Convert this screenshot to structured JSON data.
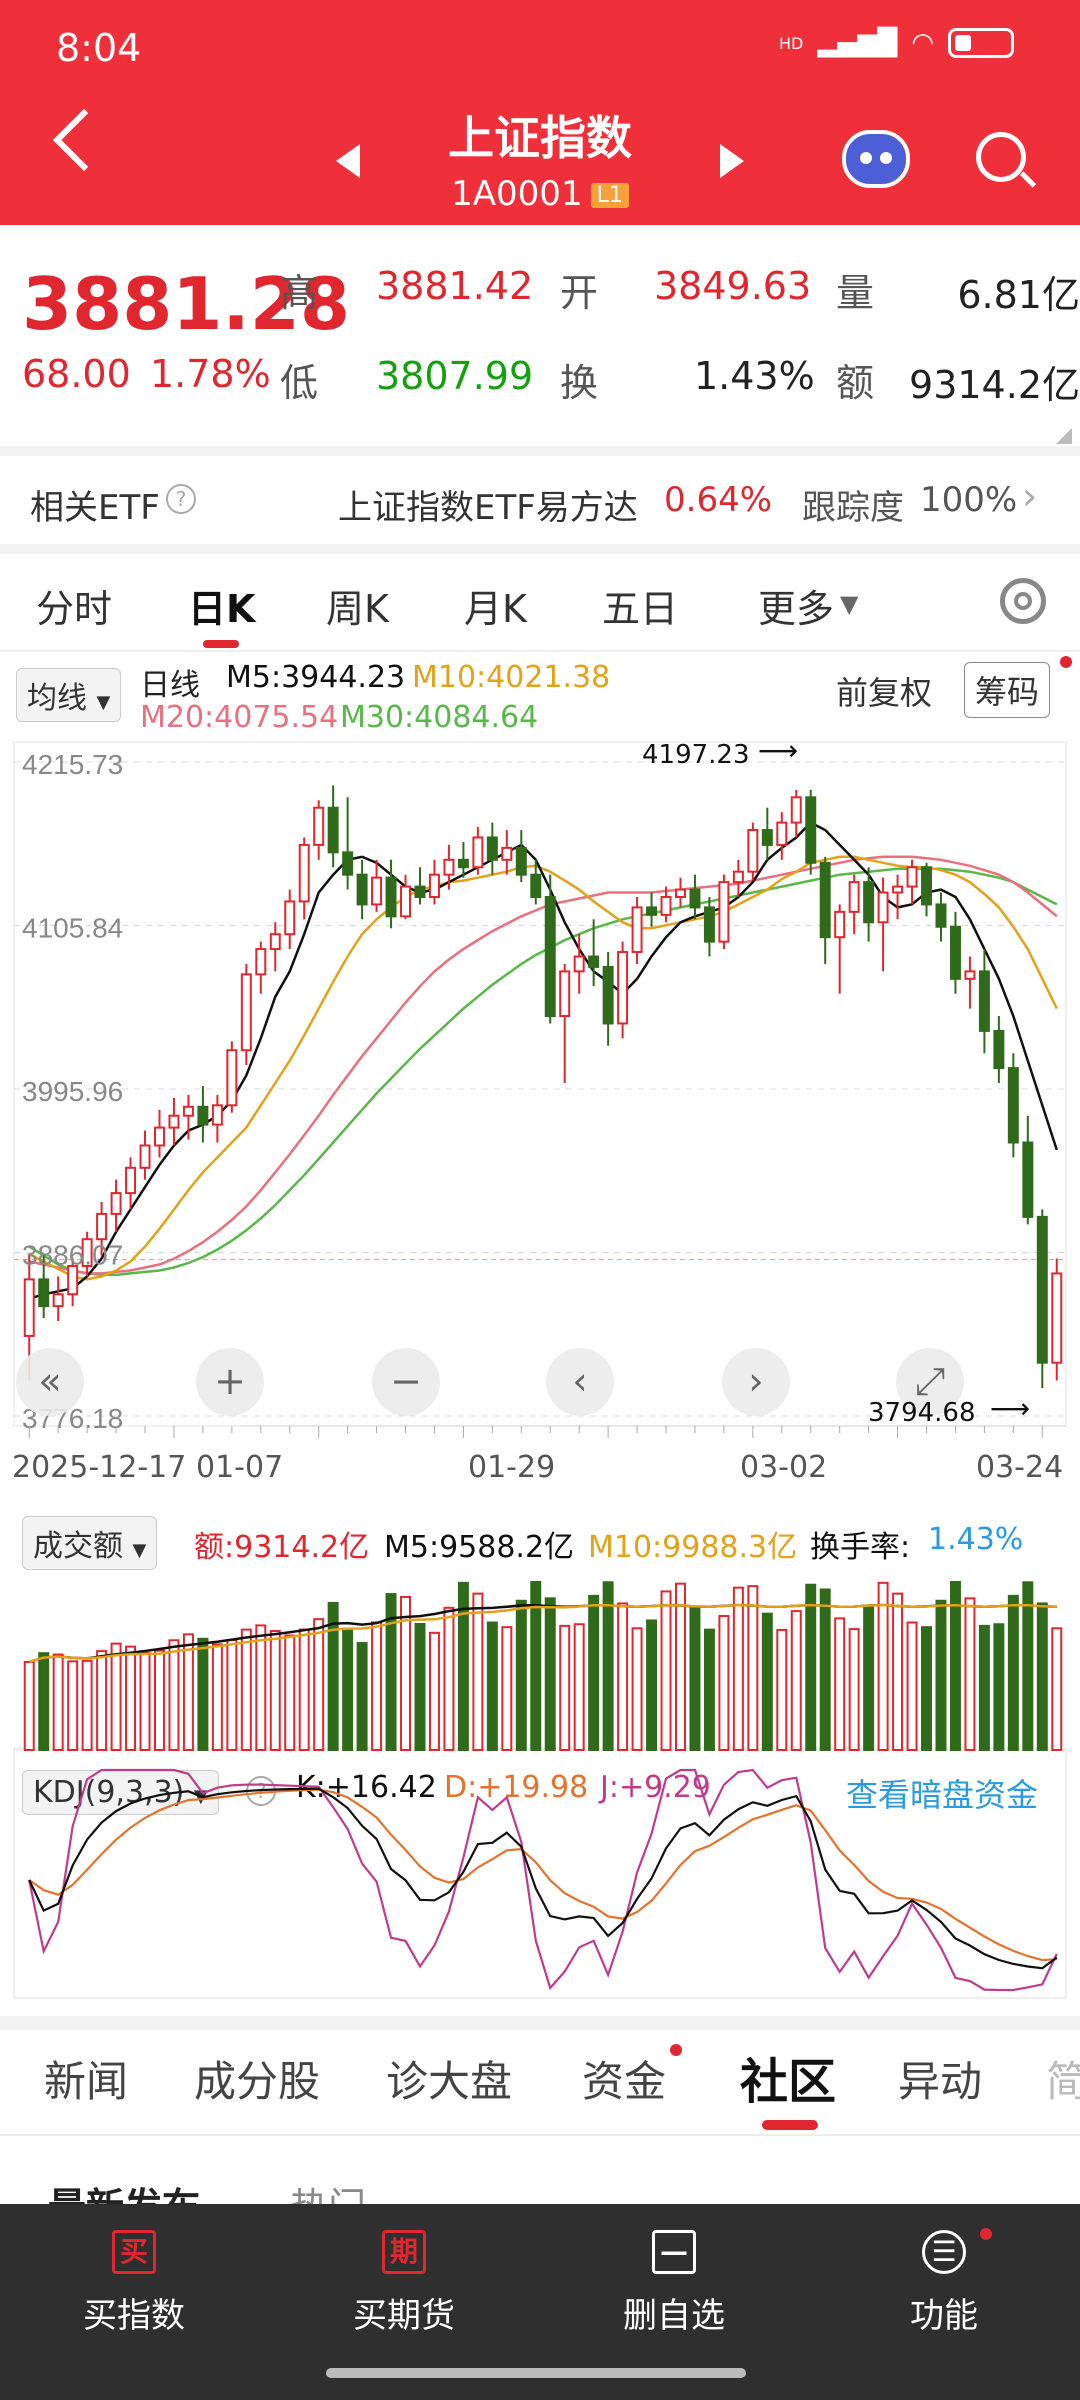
{
  "status": {
    "time": "8:04",
    "signal": "HD"
  },
  "header": {
    "title": "上证指数",
    "code": "1A0001",
    "level_badge": "L1"
  },
  "quote": {
    "price": "3881.28",
    "change": "68.00",
    "change_pct": "1.78%",
    "high_label": "高",
    "high": "3881.42",
    "open_label": "开",
    "open": "3849.63",
    "volume_label": "量",
    "volume": "6.81亿",
    "low_label": "低",
    "low": "3807.99",
    "turnover_label": "换",
    "turnover": "1.43%",
    "amount_label": "额",
    "amount": "9314.2亿"
  },
  "etf": {
    "label": "相关ETF",
    "name": "上证指数ETF易方达",
    "pct": "0.64%",
    "track_label": "跟踪度",
    "track": "100%"
  },
  "tabs": [
    "分时",
    "日K",
    "周K",
    "月K",
    "五日",
    "更多"
  ],
  "kline": {
    "ma_selector": "均线",
    "period": "日线",
    "m5": "M5:3944.23",
    "m10": "M10:4021.38",
    "m20": "M20:4075.54",
    "m30": "M30:4084.64",
    "adjust": "前复权",
    "chip_button": "筹码",
    "y_ticks": [
      "4215.73",
      "4105.84",
      "3995.96",
      "3886.07",
      "3776.18"
    ],
    "x_ticks": [
      "2025-12-17",
      "01-07",
      "01-29",
      "03-02",
      "03-24"
    ],
    "max_label": "4197.23",
    "min_label": "3794.68"
  },
  "volume": {
    "selector": "成交额",
    "amount": "额:9314.2亿",
    "m5": "M5:9588.2亿",
    "m10": "M10:9988.3亿",
    "turnover_label": "换手率:",
    "turnover": "1.43%"
  },
  "kdj": {
    "selector": "KDJ(9,3,3)",
    "k": "K:+16.42",
    "d": "D:+19.98",
    "j": "J:+9.29",
    "link": "查看暗盘资金"
  },
  "bottom_tabs": [
    "新闻",
    "成分股",
    "诊大盘",
    "资金",
    "社区",
    "异动"
  ],
  "sub_row": {
    "latest": "最新发布",
    "hot": "热门"
  },
  "nav": [
    {
      "icon": "买",
      "label": "买指数"
    },
    {
      "icon": "期",
      "label": "买期货"
    },
    {
      "icon": "—",
      "label": "删自选"
    },
    {
      "icon": "☰",
      "label": "功能"
    }
  ],
  "colors": {
    "up": "#e0262f",
    "down": "#2f6b1a",
    "header": "#ef2f3a",
    "m5": "#111111",
    "m10": "#e3a21a",
    "m20": "#e8707f",
    "m30": "#58b84a"
  },
  "chart_data": {
    "type": "candlestick",
    "ylim": [
      3776.18,
      4215.73
    ],
    "candles_ohlc": [
      [
        3830,
        3885,
        3800,
        3868
      ],
      [
        3868,
        3884,
        3842,
        3850
      ],
      [
        3850,
        3870,
        3840,
        3858
      ],
      [
        3858,
        3882,
        3850,
        3877
      ],
      [
        3877,
        3900,
        3870,
        3895
      ],
      [
        3895,
        3920,
        3884,
        3912
      ],
      [
        3912,
        3935,
        3900,
        3926
      ],
      [
        3926,
        3950,
        3915,
        3943
      ],
      [
        3943,
        3968,
        3935,
        3958
      ],
      [
        3958,
        3982,
        3950,
        3970
      ],
      [
        3970,
        3990,
        3958,
        3978
      ],
      [
        3978,
        3992,
        3962,
        3984
      ],
      [
        3984,
        3998,
        3960,
        3972
      ],
      [
        3972,
        3992,
        3960,
        3985
      ],
      [
        3985,
        4028,
        3980,
        4022
      ],
      [
        4022,
        4080,
        4012,
        4073
      ],
      [
        4073,
        4095,
        4060,
        4090
      ],
      [
        4090,
        4108,
        4075,
        4100
      ],
      [
        4100,
        4130,
        4090,
        4122
      ],
      [
        4122,
        4165,
        4110,
        4160
      ],
      [
        4160,
        4190,
        4150,
        4185
      ],
      [
        4185,
        4200,
        4145,
        4155
      ],
      [
        4155,
        4192,
        4130,
        4140
      ],
      [
        4140,
        4150,
        4110,
        4120
      ],
      [
        4120,
        4150,
        4115,
        4138
      ],
      [
        4138,
        4150,
        4104,
        4112
      ],
      [
        4112,
        4140,
        4110,
        4132
      ],
      [
        4132,
        4145,
        4120,
        4125
      ],
      [
        4125,
        4150,
        4120,
        4140
      ],
      [
        4140,
        4160,
        4130,
        4150
      ],
      [
        4150,
        4162,
        4138,
        4145
      ],
      [
        4145,
        4172,
        4140,
        4165
      ],
      [
        4165,
        4175,
        4140,
        4150
      ],
      [
        4150,
        4170,
        4140,
        4158
      ],
      [
        4158,
        4170,
        4135,
        4140
      ],
      [
        4140,
        4150,
        4120,
        4125
      ],
      [
        4125,
        4140,
        4040,
        4045
      ],
      [
        4045,
        4080,
        4000,
        4075
      ],
      [
        4075,
        4100,
        4060,
        4085
      ],
      [
        4085,
        4110,
        4065,
        4078
      ],
      [
        4078,
        4088,
        4025,
        4040
      ],
      [
        4040,
        4095,
        4030,
        4088
      ],
      [
        4088,
        4125,
        4080,
        4118
      ],
      [
        4118,
        4128,
        4105,
        4113
      ],
      [
        4113,
        4132,
        4108,
        4125
      ],
      [
        4125,
        4138,
        4118,
        4130
      ],
      [
        4130,
        4140,
        4110,
        4118
      ],
      [
        4118,
        4125,
        4085,
        4095
      ],
      [
        4095,
        4140,
        4090,
        4135
      ],
      [
        4135,
        4150,
        4125,
        4142
      ],
      [
        4142,
        4175,
        4136,
        4170
      ],
      [
        4170,
        4185,
        4150,
        4160
      ],
      [
        4160,
        4182,
        4150,
        4175
      ],
      [
        4175,
        4197,
        4165,
        4192
      ],
      [
        4192,
        4197,
        4140,
        4148
      ],
      [
        4148,
        4152,
        4080,
        4098
      ],
      [
        4098,
        4120,
        4060,
        4115
      ],
      [
        4115,
        4140,
        4100,
        4135
      ],
      [
        4135,
        4145,
        4095,
        4108
      ],
      [
        4108,
        4138,
        4075,
        4128
      ],
      [
        4128,
        4140,
        4110,
        4132
      ],
      [
        4132,
        4150,
        4120,
        4145
      ],
      [
        4145,
        4148,
        4112,
        4120
      ],
      [
        4120,
        4128,
        4095,
        4105
      ],
      [
        4105,
        4115,
        4060,
        4070
      ],
      [
        4070,
        4085,
        4050,
        4075
      ],
      [
        4075,
        4090,
        4020,
        4035
      ],
      [
        4035,
        4045,
        4000,
        4010
      ],
      [
        4010,
        4020,
        3950,
        3960
      ],
      [
        3960,
        3978,
        3905,
        3910
      ],
      [
        3910,
        3915,
        3795,
        3812
      ],
      [
        3812,
        3882,
        3800,
        3872
      ]
    ],
    "ma5": [
      3855,
      3858,
      3860,
      3862,
      3870,
      3882,
      3900,
      3915,
      3930,
      3945,
      3958,
      3968,
      3972,
      3978,
      3988,
      4005,
      4030,
      4058,
      4075,
      4100,
      4128,
      4140,
      4150,
      4152,
      4148,
      4140,
      4132,
      4128,
      4130,
      4135,
      4140,
      4145,
      4150,
      4155,
      4160,
      4150,
      4130,
      4108,
      4090,
      4075,
      4068,
      4060,
      4070,
      4085,
      4098,
      4108,
      4112,
      4115,
      4118,
      4125,
      4135,
      4150,
      4158,
      4165,
      4175,
      4170,
      4160,
      4150,
      4140,
      4125,
      4118,
      4120,
      4128,
      4130,
      4125,
      4110,
      4090,
      4070,
      4045,
      4015,
      3985,
      3955
    ],
    "ma10": [
      3885,
      3880,
      3875,
      3870,
      3868,
      3870,
      3874,
      3880,
      3890,
      3902,
      3915,
      3928,
      3940,
      3950,
      3960,
      3970,
      3985,
      4000,
      4015,
      4032,
      4050,
      4068,
      4085,
      4100,
      4110,
      4118,
      4125,
      4130,
      4132,
      4135,
      4136,
      4138,
      4140,
      4142,
      4145,
      4146,
      4142,
      4136,
      4130,
      4122,
      4115,
      4108,
      4104,
      4104,
      4106,
      4108,
      4110,
      4112,
      4115,
      4120,
      4125,
      4130,
      4137,
      4142,
      4148,
      4150,
      4152,
      4152,
      4150,
      4148,
      4146,
      4145,
      4145,
      4143,
      4140,
      4135,
      4127,
      4118,
      4105,
      4090,
      4070,
      4050
    ],
    "ma20": [
      3880,
      3878,
      3876,
      3874,
      3872,
      3872,
      3873,
      3874,
      3876,
      3878,
      3882,
      3887,
      3893,
      3900,
      3908,
      3917,
      3928,
      3940,
      3952,
      3965,
      3978,
      3992,
      4005,
      4018,
      4030,
      4042,
      4054,
      4065,
      4075,
      4083,
      4090,
      4096,
      4102,
      4107,
      4112,
      4116,
      4120,
      4122,
      4124,
      4126,
      4128,
      4128,
      4128,
      4128,
      4129,
      4130,
      4131,
      4132,
      4133,
      4134,
      4136,
      4138,
      4140,
      4142,
      4144,
      4146,
      4148,
      4150,
      4151,
      4152,
      4152,
      4152,
      4151,
      4150,
      4148,
      4146,
      4143,
      4140,
      4135,
      4128,
      4120,
      4112
    ],
    "ma30": [
      3890,
      3884,
      3878,
      3874,
      3872,
      3871,
      3871,
      3872,
      3873,
      3874,
      3876,
      3879,
      3883,
      3888,
      3894,
      3901,
      3909,
      3918,
      3928,
      3938,
      3949,
      3960,
      3971,
      3982,
      3993,
      4003,
      4013,
      4023,
      4032,
      4041,
      4050,
      4058,
      4066,
      4073,
      4080,
      4086,
      4091,
      4096,
      4100,
      4104,
      4107,
      4110,
      4112,
      4114,
      4116,
      4118,
      4120,
      4122,
      4124,
      4126,
      4128,
      4130,
      4132,
      4134,
      4136,
      4138,
      4140,
      4141,
      4142,
      4143,
      4144,
      4144,
      4144,
      4144,
      4143,
      4142,
      4140,
      4138,
      4135,
      4130,
      4125,
      4120
    ]
  }
}
